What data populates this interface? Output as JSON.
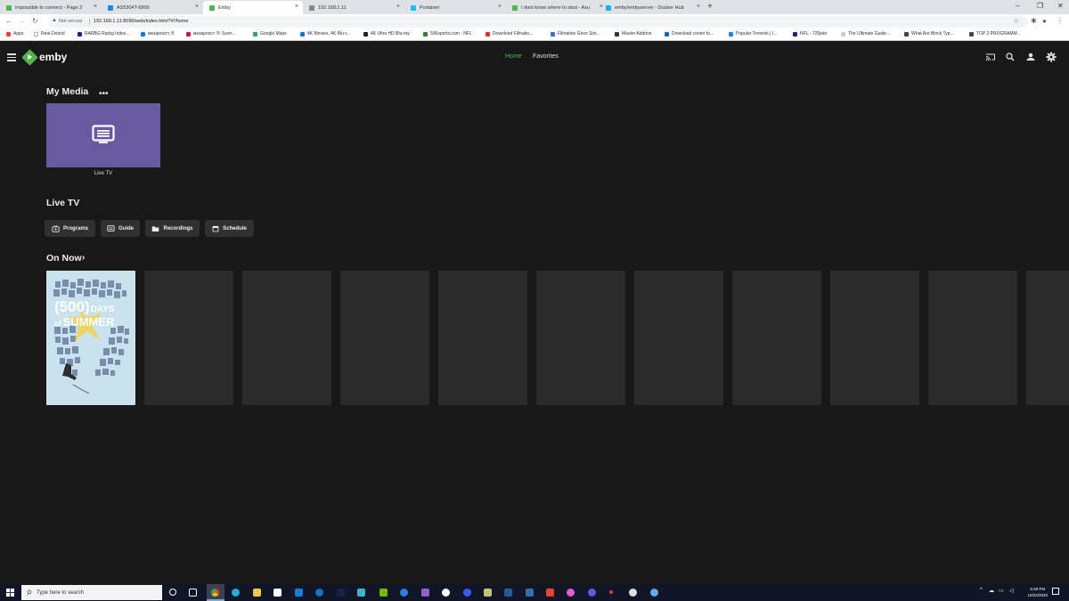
{
  "browser": {
    "tabs": [
      {
        "title": "impossible to connect - Page 3",
        "color": "#52b54b"
      },
      {
        "title": "AS5304T-6800",
        "color": "#1e88e5"
      },
      {
        "title": "Emby",
        "color": "#52b54b",
        "active": true
      },
      {
        "title": "192.168.1.11",
        "color": "#888888"
      },
      {
        "title": "Portainer",
        "color": "#13bef9"
      },
      {
        "title": "I dont know where to start - Asu",
        "color": "#52b54b"
      },
      {
        "title": "emby/embyserver - Docker Hub",
        "color": "#0db7ed"
      }
    ],
    "not_secure": "Not secure",
    "url": "192.168.1.11:8096/web/index.html?#!/home",
    "bookmarks": [
      {
        "label": "Apps",
        "color": "#e94235"
      },
      {
        "label": "Real-Debrid",
        "color": "#ffffff"
      },
      {
        "label": "RARBG Rarbg Index...",
        "color": "#1a237e"
      },
      {
        "label": "мезароост ®",
        "color": "#1a73e8"
      },
      {
        "label": "мезароост ®: Scen...",
        "color": "#c2185b"
      },
      {
        "label": "Google Maps",
        "color": "#34a853"
      },
      {
        "label": "4K Movies, 4K Blu-r...",
        "color": "#1a73e8"
      },
      {
        "label": "4K Ultra HD Blu-ray",
        "color": "#222222"
      },
      {
        "label": "506sports.com - NFL",
        "color": "#2e7d32"
      },
      {
        "label": "Download Filmatio...",
        "color": "#d93025"
      },
      {
        "label": "Filmation Goes Sini...",
        "color": "#3c6fd8"
      },
      {
        "label": "Master Addons",
        "color": "#333333"
      },
      {
        "label": "Download center fo...",
        "color": "#1565c0"
      },
      {
        "label": "Popular Torrents | I...",
        "color": "#1e88e5"
      },
      {
        "label": "NFL - 720pier",
        "color": "#1a237e"
      },
      {
        "label": "The Ultimate Guide...",
        "color": "#cccccc"
      },
      {
        "label": "What Are Block Typ...",
        "color": "#444444"
      },
      {
        "label": "TOP 2 PROGRAMM...",
        "color": "#444444"
      }
    ]
  },
  "app": {
    "logo_text": "emby",
    "accent_color": "#52b54b",
    "nav": {
      "home": "Home",
      "favorites": "Favorites"
    },
    "header_icons": [
      "cast-icon",
      "search-icon",
      "user-icon",
      "settings-icon"
    ],
    "my_media": {
      "title": "My Media",
      "more": "•••",
      "libraries": [
        {
          "label": "Live TV",
          "color": "#685aa0"
        }
      ]
    },
    "live_tv": {
      "title": "Live TV",
      "buttons": [
        {
          "label": "Programs",
          "icon": "programs-icon"
        },
        {
          "label": "Guide",
          "icon": "guide-icon"
        },
        {
          "label": "Recordings",
          "icon": "folder-icon"
        },
        {
          "label": "Schedule",
          "icon": "calendar-icon"
        }
      ]
    },
    "on_now": {
      "title": "On Now",
      "arrow": "›",
      "poster": {
        "line1": "(500)",
        "line2": "DAYS",
        "line3": "of",
        "line4": "SUMMER"
      }
    }
  },
  "taskbar": {
    "search_placeholder": "Type here to search",
    "time": "5:48 PM",
    "date": "10/22/2020"
  }
}
